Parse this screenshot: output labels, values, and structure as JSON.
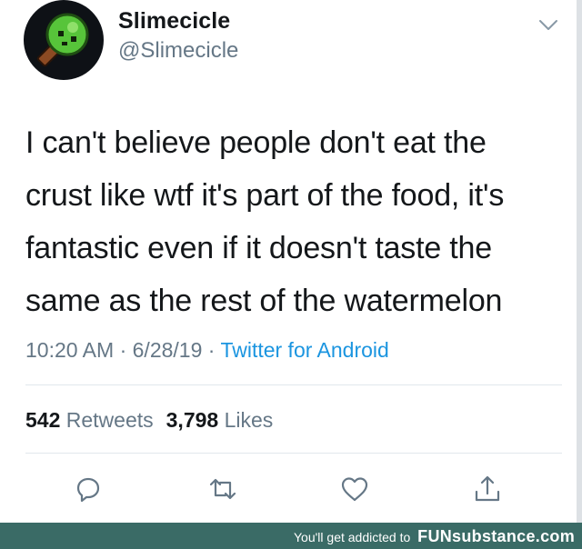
{
  "tweet": {
    "author": {
      "display_name": "Slimecicle",
      "handle": "@Slimecicle",
      "avatar_icon": "green-slime-popsicle-icon"
    },
    "menu_icon": "chevron-down-icon",
    "text_lines": [
      "I can't believe people don't eat the",
      "crust like wtf it's part of the food, it's",
      "fantastic even if it doesn't taste the",
      "same as the rest of the watermelon"
    ],
    "time": "10:20 AM",
    "date": "6/28/19",
    "separator": "·",
    "source": "Twitter for Android",
    "stats": {
      "retweets_count": "542",
      "retweets_label": "Retweets",
      "likes_count": "3,798",
      "likes_label": "Likes"
    },
    "actions": [
      "reply-icon",
      "retweet-icon",
      "like-icon",
      "share-icon"
    ]
  },
  "footer": {
    "tagline": "You'll get addicted to",
    "brand": "FUNsubstance.com"
  },
  "colors": {
    "text": "#14171a",
    "muted": "#657786",
    "link": "#1b95e0",
    "footer_bg": "#3a6b66"
  }
}
